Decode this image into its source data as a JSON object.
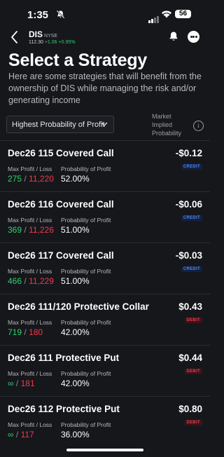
{
  "status": {
    "time": "1:35",
    "battery": "56"
  },
  "header": {
    "ticker": "DIS",
    "exchange": "NYSE",
    "price": "112.30",
    "change": "+1.06",
    "change_pct": "+0.95%"
  },
  "page": {
    "title": "Select a Strategy",
    "description": "Here are some strategies that will benefit from the ownership of DIS while managing the risk and/or generating income",
    "sort_label": "Highest Probability of Profit",
    "mip_label": "Market Implied Probability"
  },
  "labels": {
    "maxpl": "Max Profit / Loss",
    "prob": "Probability of Profit",
    "separator": "/"
  },
  "strategies": [
    {
      "name": "Dec26 115 Covered Call",
      "price": "-$0.12",
      "badge": "CREDIT",
      "profit": "275",
      "loss": "11,220",
      "prob": "52.00%"
    },
    {
      "name": "Dec26 116 Covered Call",
      "price": "-$0.06",
      "badge": "CREDIT",
      "profit": "369",
      "loss": "11,226",
      "prob": "51.00%"
    },
    {
      "name": "Dec26 117 Covered Call",
      "price": "-$0.03",
      "badge": "CREDIT",
      "profit": "466",
      "loss": "11,229",
      "prob": "51.00%"
    },
    {
      "name": "Dec26 111/120 Protective Collar",
      "price": "$0.43",
      "badge": "DEBIT",
      "profit": "719",
      "loss": "180",
      "prob": "42.00%"
    },
    {
      "name": "Dec26 111 Protective Put",
      "price": "$0.44",
      "badge": "DEBIT",
      "profit": "∞",
      "loss": "181",
      "prob": "42.00%"
    },
    {
      "name": "Dec26 112 Protective Put",
      "price": "$0.80",
      "badge": "DEBIT",
      "profit": "∞",
      "loss": "117",
      "prob": "36.00%"
    }
  ],
  "colors": {
    "background": "#16171b",
    "profit": "#2fd06e",
    "loss": "#f03a4b",
    "credit": "#4b86ff",
    "debit": "#e8394a"
  },
  "icons": [
    "back-chevron-icon",
    "bell-icon",
    "more-icon",
    "chevron-down-icon",
    "info-icon",
    "mute-icon",
    "wifi-icon",
    "signal-icon"
  ]
}
